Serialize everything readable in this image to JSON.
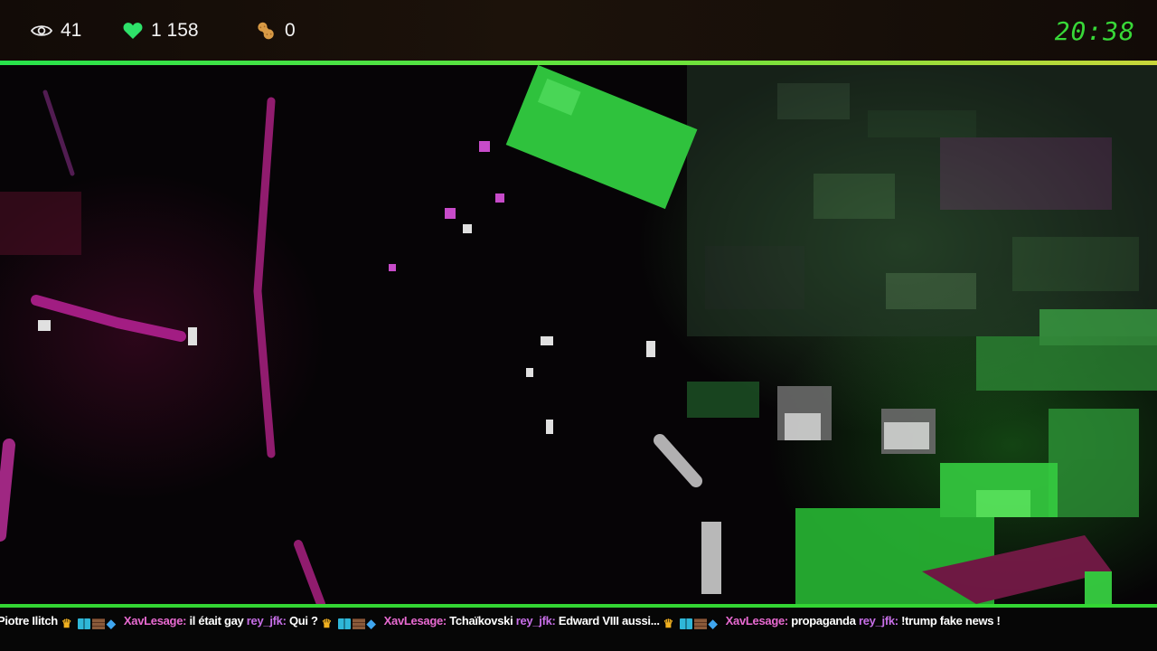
{
  "stats": {
    "viewers": {
      "icon": "eye-icon",
      "value": "41"
    },
    "likes": {
      "icon": "heart-icon",
      "value": "1 158",
      "color": "#2ee16a"
    },
    "peanuts": {
      "icon": "peanut-icon",
      "value": "0",
      "color": "#d89a45"
    }
  },
  "clock": "20:38",
  "progress": {
    "fraction": 1.0,
    "colors": [
      "#27e34b",
      "#c8d63a"
    ]
  },
  "chat": {
    "messages": [
      {
        "user": "",
        "text": "Piotre Ilitch",
        "badges": [
          "crown-icon",
          "grid-icon",
          "brick-icon",
          "cube-icon"
        ]
      },
      {
        "user": "XavLesage:",
        "text": "il était gay",
        "badges": []
      },
      {
        "user": "rey_jfk:",
        "text": "Qui ?",
        "badges": [
          "crown-icon",
          "grid-icon",
          "brick-icon",
          "cube-icon"
        ]
      },
      {
        "user": "XavLesage:",
        "text": "Tchaïkovski",
        "badges": []
      },
      {
        "user": "rey_jfk:",
        "text": "Edward VIII aussi...",
        "badges": [
          "crown-icon",
          "grid-icon",
          "brick-icon",
          "cube-icon"
        ]
      },
      {
        "user": "XavLesage:",
        "text": "propaganda",
        "badges": []
      },
      {
        "user": "rey_jfk:",
        "text": "!trump fake news !",
        "badges": []
      }
    ],
    "accent": "#33d633",
    "user_color": "#e86ad1"
  }
}
